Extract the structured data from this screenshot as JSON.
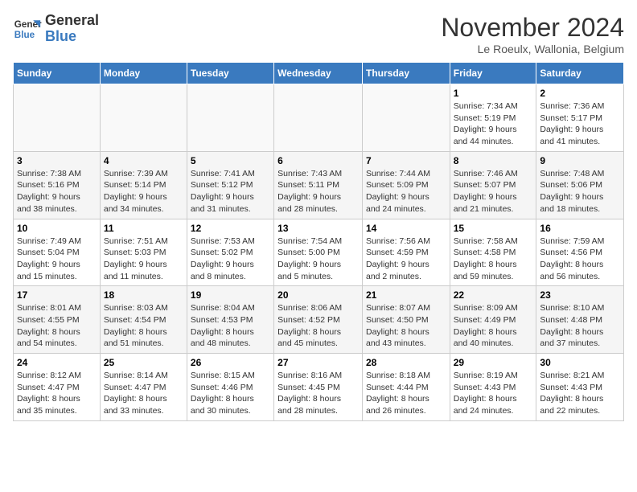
{
  "logo": {
    "line1": "General",
    "line2": "Blue"
  },
  "title": "November 2024",
  "subtitle": "Le Roeulx, Wallonia, Belgium",
  "weekdays": [
    "Sunday",
    "Monday",
    "Tuesday",
    "Wednesday",
    "Thursday",
    "Friday",
    "Saturday"
  ],
  "weeks": [
    [
      {
        "day": "",
        "info": ""
      },
      {
        "day": "",
        "info": ""
      },
      {
        "day": "",
        "info": ""
      },
      {
        "day": "",
        "info": ""
      },
      {
        "day": "",
        "info": ""
      },
      {
        "day": "1",
        "info": "Sunrise: 7:34 AM\nSunset: 5:19 PM\nDaylight: 9 hours\nand 44 minutes."
      },
      {
        "day": "2",
        "info": "Sunrise: 7:36 AM\nSunset: 5:17 PM\nDaylight: 9 hours\nand 41 minutes."
      }
    ],
    [
      {
        "day": "3",
        "info": "Sunrise: 7:38 AM\nSunset: 5:16 PM\nDaylight: 9 hours\nand 38 minutes."
      },
      {
        "day": "4",
        "info": "Sunrise: 7:39 AM\nSunset: 5:14 PM\nDaylight: 9 hours\nand 34 minutes."
      },
      {
        "day": "5",
        "info": "Sunrise: 7:41 AM\nSunset: 5:12 PM\nDaylight: 9 hours\nand 31 minutes."
      },
      {
        "day": "6",
        "info": "Sunrise: 7:43 AM\nSunset: 5:11 PM\nDaylight: 9 hours\nand 28 minutes."
      },
      {
        "day": "7",
        "info": "Sunrise: 7:44 AM\nSunset: 5:09 PM\nDaylight: 9 hours\nand 24 minutes."
      },
      {
        "day": "8",
        "info": "Sunrise: 7:46 AM\nSunset: 5:07 PM\nDaylight: 9 hours\nand 21 minutes."
      },
      {
        "day": "9",
        "info": "Sunrise: 7:48 AM\nSunset: 5:06 PM\nDaylight: 9 hours\nand 18 minutes."
      }
    ],
    [
      {
        "day": "10",
        "info": "Sunrise: 7:49 AM\nSunset: 5:04 PM\nDaylight: 9 hours\nand 15 minutes."
      },
      {
        "day": "11",
        "info": "Sunrise: 7:51 AM\nSunset: 5:03 PM\nDaylight: 9 hours\nand 11 minutes."
      },
      {
        "day": "12",
        "info": "Sunrise: 7:53 AM\nSunset: 5:02 PM\nDaylight: 9 hours\nand 8 minutes."
      },
      {
        "day": "13",
        "info": "Sunrise: 7:54 AM\nSunset: 5:00 PM\nDaylight: 9 hours\nand 5 minutes."
      },
      {
        "day": "14",
        "info": "Sunrise: 7:56 AM\nSunset: 4:59 PM\nDaylight: 9 hours\nand 2 minutes."
      },
      {
        "day": "15",
        "info": "Sunrise: 7:58 AM\nSunset: 4:58 PM\nDaylight: 8 hours\nand 59 minutes."
      },
      {
        "day": "16",
        "info": "Sunrise: 7:59 AM\nSunset: 4:56 PM\nDaylight: 8 hours\nand 56 minutes."
      }
    ],
    [
      {
        "day": "17",
        "info": "Sunrise: 8:01 AM\nSunset: 4:55 PM\nDaylight: 8 hours\nand 54 minutes."
      },
      {
        "day": "18",
        "info": "Sunrise: 8:03 AM\nSunset: 4:54 PM\nDaylight: 8 hours\nand 51 minutes."
      },
      {
        "day": "19",
        "info": "Sunrise: 8:04 AM\nSunset: 4:53 PM\nDaylight: 8 hours\nand 48 minutes."
      },
      {
        "day": "20",
        "info": "Sunrise: 8:06 AM\nSunset: 4:52 PM\nDaylight: 8 hours\nand 45 minutes."
      },
      {
        "day": "21",
        "info": "Sunrise: 8:07 AM\nSunset: 4:50 PM\nDaylight: 8 hours\nand 43 minutes."
      },
      {
        "day": "22",
        "info": "Sunrise: 8:09 AM\nSunset: 4:49 PM\nDaylight: 8 hours\nand 40 minutes."
      },
      {
        "day": "23",
        "info": "Sunrise: 8:10 AM\nSunset: 4:48 PM\nDaylight: 8 hours\nand 37 minutes."
      }
    ],
    [
      {
        "day": "24",
        "info": "Sunrise: 8:12 AM\nSunset: 4:47 PM\nDaylight: 8 hours\nand 35 minutes."
      },
      {
        "day": "25",
        "info": "Sunrise: 8:14 AM\nSunset: 4:47 PM\nDaylight: 8 hours\nand 33 minutes."
      },
      {
        "day": "26",
        "info": "Sunrise: 8:15 AM\nSunset: 4:46 PM\nDaylight: 8 hours\nand 30 minutes."
      },
      {
        "day": "27",
        "info": "Sunrise: 8:16 AM\nSunset: 4:45 PM\nDaylight: 8 hours\nand 28 minutes."
      },
      {
        "day": "28",
        "info": "Sunrise: 8:18 AM\nSunset: 4:44 PM\nDaylight: 8 hours\nand 26 minutes."
      },
      {
        "day": "29",
        "info": "Sunrise: 8:19 AM\nSunset: 4:43 PM\nDaylight: 8 hours\nand 24 minutes."
      },
      {
        "day": "30",
        "info": "Sunrise: 8:21 AM\nSunset: 4:43 PM\nDaylight: 8 hours\nand 22 minutes."
      }
    ]
  ]
}
